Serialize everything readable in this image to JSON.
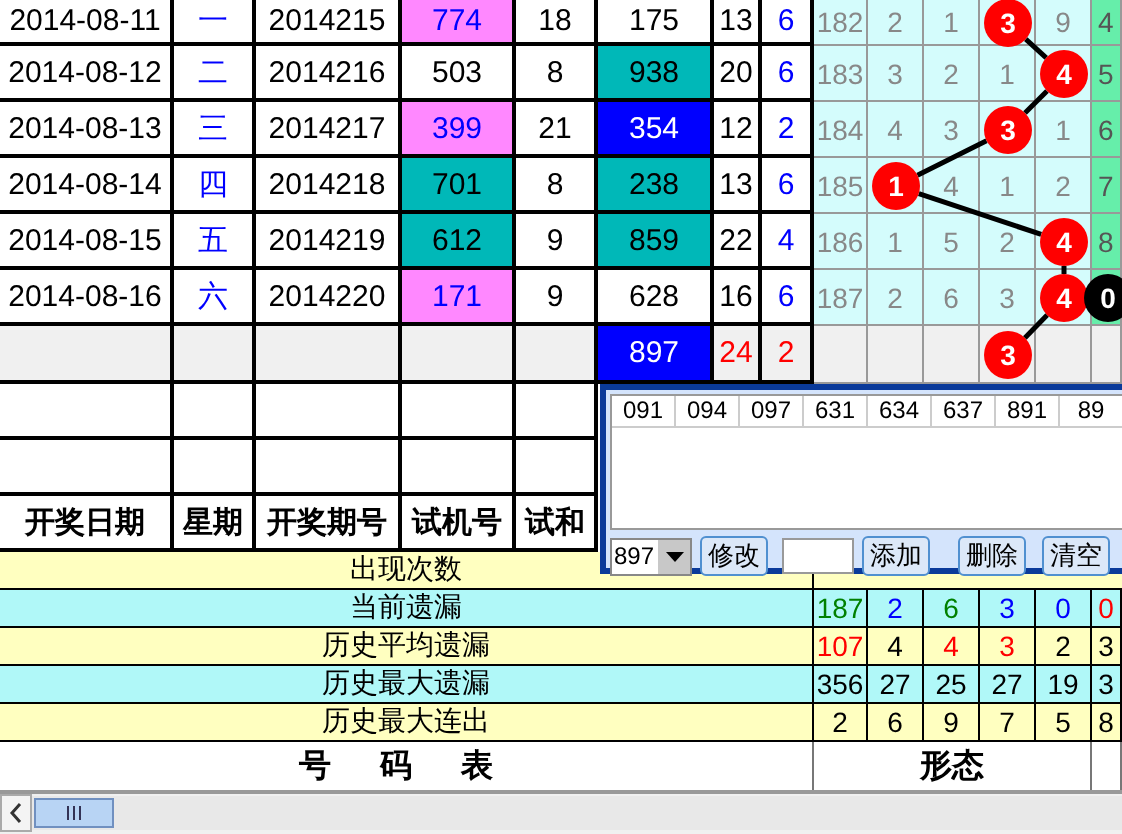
{
  "rows": [
    {
      "date": "2014-08-11",
      "weekday": "一",
      "issue": "2014215",
      "test_number": {
        "text": "774",
        "color": "#ff88ff"
      },
      "test_sum": "18",
      "number": {
        "text": "175"
      },
      "sum": "13",
      "span": "6",
      "miss": "182",
      "pattern": [
        {
          "kind": "plain",
          "text": "2"
        },
        {
          "kind": "plain",
          "text": "1"
        },
        {
          "kind": "ball",
          "text": "3"
        },
        {
          "kind": "plain",
          "text": "9"
        },
        {
          "kind": "plain",
          "text": "4"
        }
      ]
    },
    {
      "date": "2014-08-12",
      "weekday": "二",
      "issue": "2014216",
      "test_number": {
        "text": "503"
      },
      "test_sum": "8",
      "number": {
        "text": "938",
        "color": "#00b8b8"
      },
      "sum": "20",
      "span": "6",
      "miss": "183",
      "pattern": [
        {
          "kind": "plain",
          "text": "3"
        },
        {
          "kind": "plain",
          "text": "2"
        },
        {
          "kind": "plain",
          "text": "1"
        },
        {
          "kind": "ball",
          "text": "4"
        },
        {
          "kind": "plain",
          "text": "5"
        }
      ]
    },
    {
      "date": "2014-08-13",
      "weekday": "三",
      "issue": "2014217",
      "test_number": {
        "text": "399",
        "color": "#ff88ff"
      },
      "test_sum": "21",
      "number": {
        "text": "354",
        "color": "#0000ff"
      },
      "sum": "12",
      "span": "2",
      "miss": "184",
      "pattern": [
        {
          "kind": "plain",
          "text": "4"
        },
        {
          "kind": "plain",
          "text": "3"
        },
        {
          "kind": "ball",
          "text": "3"
        },
        {
          "kind": "plain",
          "text": "1"
        },
        {
          "kind": "plain",
          "text": "6"
        }
      ]
    },
    {
      "date": "2014-08-14",
      "weekday": "四",
      "issue": "2014218",
      "test_number": {
        "text": "701",
        "color": "#00b8b8"
      },
      "test_sum": "8",
      "number": {
        "text": "238",
        "color": "#00b8b8"
      },
      "sum": "13",
      "span": "6",
      "miss": "185",
      "pattern": [
        {
          "kind": "ball",
          "text": "1"
        },
        {
          "kind": "plain",
          "text": "4"
        },
        {
          "kind": "plain",
          "text": "1"
        },
        {
          "kind": "plain",
          "text": "2"
        },
        {
          "kind": "plain",
          "text": "7"
        }
      ]
    },
    {
      "date": "2014-08-15",
      "weekday": "五",
      "issue": "2014219",
      "test_number": {
        "text": "612",
        "color": "#00b8b8"
      },
      "test_sum": "9",
      "number": {
        "text": "859",
        "color": "#00b8b8"
      },
      "sum": "22",
      "span": "4",
      "miss": "186",
      "pattern": [
        {
          "kind": "plain",
          "text": "1"
        },
        {
          "kind": "plain",
          "text": "5"
        },
        {
          "kind": "plain",
          "text": "2"
        },
        {
          "kind": "ball",
          "text": "4"
        },
        {
          "kind": "plain",
          "text": "8"
        }
      ]
    },
    {
      "date": "2014-08-16",
      "weekday": "六",
      "issue": "2014220",
      "test_number": {
        "text": "171",
        "color": "#ff88ff"
      },
      "test_sum": "9",
      "number": {
        "text": "628"
      },
      "sum": "16",
      "span": "6",
      "miss": "187",
      "pattern": [
        {
          "kind": "plain",
          "text": "2"
        },
        {
          "kind": "plain",
          "text": "6"
        },
        {
          "kind": "plain",
          "text": "3"
        },
        {
          "kind": "ball",
          "text": "4"
        },
        {
          "kind": "dark_ball",
          "text": "0"
        }
      ]
    }
  ],
  "summary": {
    "number": {
      "text": "897",
      "color": "#0000ff"
    },
    "sum": {
      "text": "24",
      "color": "#ff0000"
    },
    "span": {
      "text": "2",
      "color": "#ff0000"
    },
    "pattern": [
      {
        "kind": "blank"
      },
      {
        "kind": "blank"
      },
      {
        "kind": "ball",
        "text": "3"
      },
      {
        "kind": "blank"
      },
      {
        "kind": "blank"
      }
    ]
  },
  "header": [
    "开奖日期",
    "星期",
    "开奖期号",
    "试机号",
    "试和"
  ],
  "stats": [
    {
      "label": "出现次数",
      "color": "#ffffc0"
    },
    {
      "label": "当前遗漏",
      "color": "#b0f8f8",
      "values": [
        {
          "text": "187",
          "color": "#008000"
        },
        {
          "text": "2",
          "color": "#0000ff"
        },
        {
          "text": "6",
          "color": "#008000"
        },
        {
          "text": "3",
          "color": "#0000ff"
        },
        {
          "text": "0",
          "color": "#0000ff"
        },
        {
          "text": "0",
          "color": "#ff0000"
        }
      ]
    },
    {
      "label": "历史平均遗漏",
      "color": "#ffffc0",
      "values": [
        {
          "text": "107",
          "color": "#ff0000"
        },
        {
          "text": "4",
          "color": "#000000"
        },
        {
          "text": "4",
          "color": "#ff0000"
        },
        {
          "text": "3",
          "color": "#ff0000"
        },
        {
          "text": "2",
          "color": "#000000"
        },
        {
          "text": "3",
          "color": "#000000"
        }
      ]
    },
    {
      "label": "历史最大遗漏",
      "color": "#b0f8f8",
      "values": [
        {
          "text": "356",
          "color": "#000000"
        },
        {
          "text": "27",
          "color": "#000000"
        },
        {
          "text": "25",
          "color": "#000000"
        },
        {
          "text": "27",
          "color": "#000000"
        },
        {
          "text": "19",
          "color": "#000000"
        },
        {
          "text": "3",
          "color": "#000000"
        }
      ]
    },
    {
      "label": "历史最大连出",
      "color": "#ffffc0",
      "values": [
        {
          "text": "2",
          "color": "#000000"
        },
        {
          "text": "6",
          "color": "#000000"
        },
        {
          "text": "9",
          "color": "#000000"
        },
        {
          "text": "7",
          "color": "#000000"
        },
        {
          "text": "5",
          "color": "#000000"
        },
        {
          "text": "8",
          "color": "#000000"
        }
      ]
    }
  ],
  "footer": {
    "title": "号 码 表",
    "pattern_title": "形态"
  },
  "popup": {
    "columns": [
      "091",
      "094",
      "097",
      "631",
      "634",
      "637",
      "891",
      "89"
    ],
    "combo": {
      "value": "897"
    },
    "controls": [
      {
        "kind": "button",
        "label": "修改"
      },
      {
        "kind": "input"
      },
      {
        "kind": "button",
        "label": "添加"
      },
      {
        "kind": "button",
        "label": "删除"
      },
      {
        "kind": "button",
        "label": "清空"
      }
    ]
  }
}
